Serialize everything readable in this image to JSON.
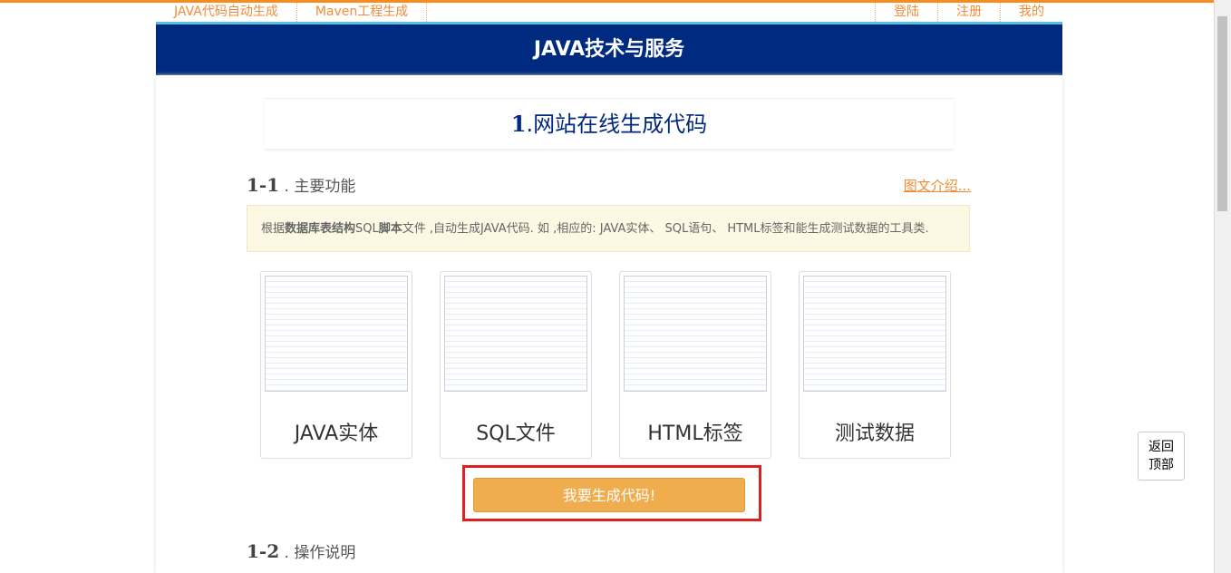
{
  "nav": {
    "left": [
      "JAVA代码自动生成",
      "Maven工程生成"
    ],
    "right": [
      "登陆",
      "注册",
      "我的"
    ]
  },
  "header": {
    "title": "JAVA技术与服务"
  },
  "main": {
    "title_num": "1",
    "title": ".网站在线生成代码",
    "s1_num": "1-1",
    "s1_label": ". 主要功能",
    "intro_link": "图文介绍...",
    "notice": {
      "pre": "根据",
      "b1": "数据库表结构",
      "mid": "SQL",
      "b2": "脚本",
      "post": "文件 ,自动生成JAVA代码. 如 ,相应的: JAVA实体、 SQL语句、 HTML标签和能生成测试数据的工具类."
    },
    "cards": [
      {
        "label": "JAVA实体"
      },
      {
        "label": "SQL文件"
      },
      {
        "label": "HTML标签"
      },
      {
        "label": "测试数据"
      }
    ],
    "generate_button": "我要生成代码!",
    "s2_num": "1-2",
    "s2_label": ". 操作说明"
  },
  "back_to_top": [
    "返回",
    "顶部"
  ]
}
